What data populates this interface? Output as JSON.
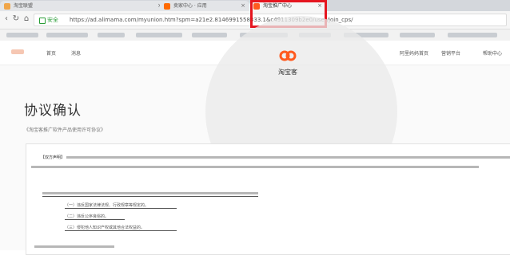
{
  "browser": {
    "tabs": [
      {
        "label": "淘宝联盟",
        "active": false
      },
      {
        "label": "卖家中心 · 应用",
        "active": false
      },
      {
        "label": "淘宝推广中心",
        "active": true
      }
    ],
    "secure_label": "安全",
    "url": "https://ad.alimama.com/myunion.htm?spm=a21e2.8146991558333.1&c4911309b2e0/user/join_cps/",
    "highlight_color": "#e5151f"
  },
  "site": {
    "nav": {
      "left": [
        "首页",
        "消息"
      ],
      "right": [
        "阿里妈妈首页",
        "营销平台",
        "帮助中心"
      ]
    },
    "brand": {
      "name": "淘宝客",
      "color": "#ff5a1f"
    }
  },
  "agreement": {
    "title": "协议确认",
    "subtitle": "《淘宝客推广软件产品使用许可协议》",
    "para_lead": "【双方声明】",
    "item1": "（一）违反国家法律法规、行政规章等规定的。",
    "item2": "（二）违反公序良俗的。",
    "item3": "（三）侵犯他人知识产权或其他合法权益的。"
  }
}
